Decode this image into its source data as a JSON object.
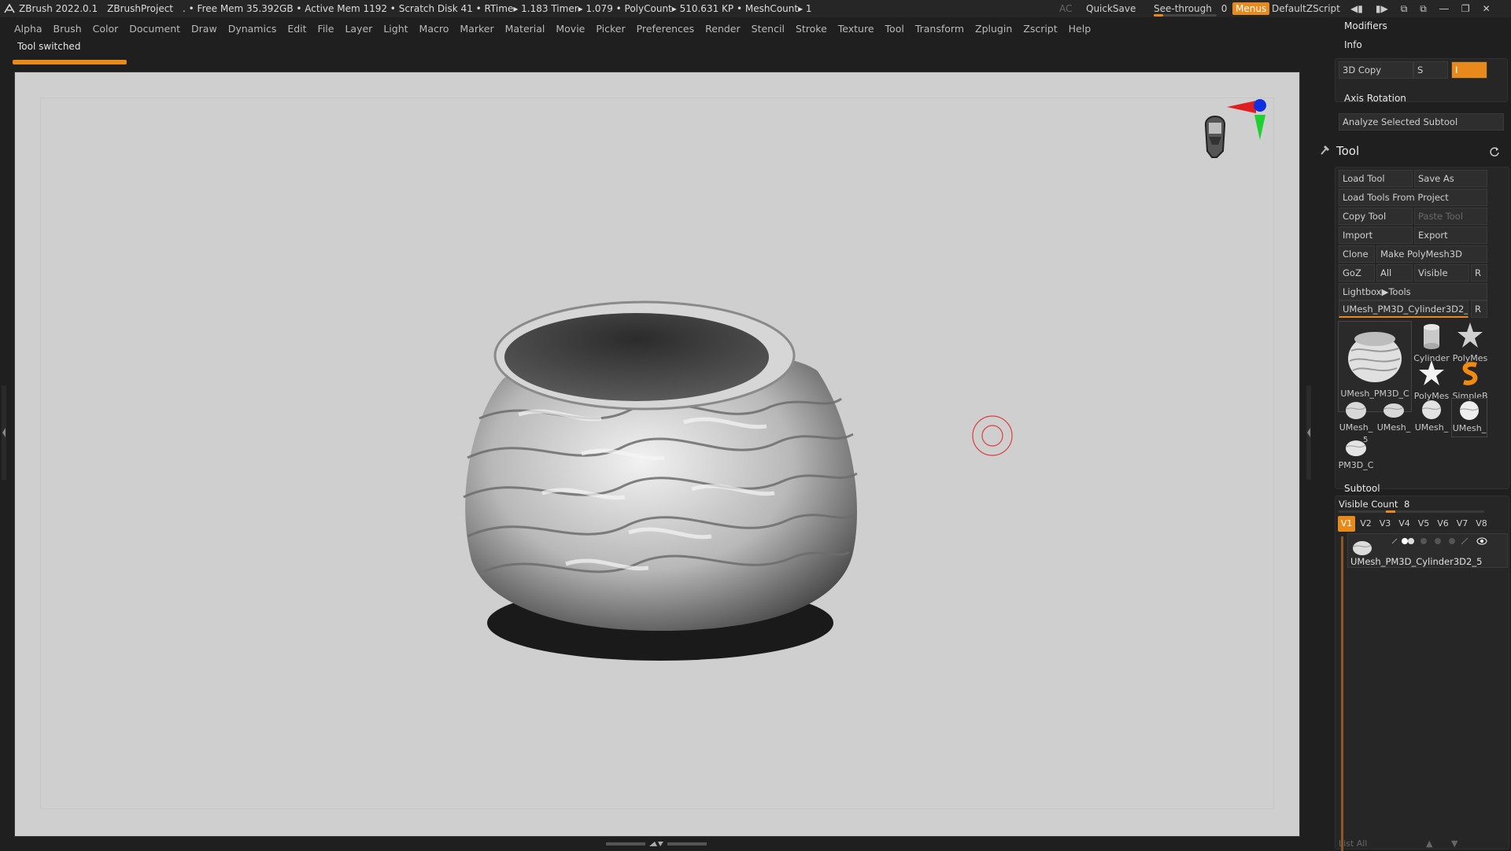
{
  "titlebar": {
    "app": "ZBrush 2022.0.1",
    "project": "ZBrushProject",
    "stats": ". • Free Mem 35.392GB • Active Mem 1192 • Scratch Disk 41 • RTime▸ 1.183 Timer▸ 1.079 • PolyCount▸ 510.631 KP • MeshCount▸ 1",
    "ac": "AC",
    "quicksave": "QuickSave",
    "seethrough_label": "See-through",
    "seethrough_value": "0",
    "seethrough_fraction": 0,
    "menus": "Menus",
    "script": "DefaultZScript"
  },
  "menubar": [
    "Alpha",
    "Brush",
    "Color",
    "Document",
    "Draw",
    "Dynamics",
    "Edit",
    "File",
    "Layer",
    "Light",
    "Macro",
    "Marker",
    "Material",
    "Movie",
    "Picker",
    "Preferences",
    "Render",
    "Stencil",
    "Stroke",
    "Texture",
    "Tool",
    "Transform",
    "Zplugin",
    "Zscript",
    "Help"
  ],
  "notification": {
    "text": "Tool switched"
  },
  "colors": {
    "accent": "#e8891c",
    "canvas": "#cfcfcf",
    "panel": "#1f1f1f"
  },
  "panel": {
    "modifiers": "Modifiers",
    "info": "Info",
    "copy3d": "3D Copy",
    "copy3d_s": "S",
    "copy3d_i": "I",
    "axis_rotation": "Axis Rotation",
    "analyze": "Analyze Selected Subtool",
    "tool_title": "Tool",
    "buttons": {
      "load_tool": "Load Tool",
      "save_as": "Save As",
      "load_from_project": "Load Tools From Project",
      "copy_tool": "Copy Tool",
      "paste_tool": "Paste Tool",
      "import": "Import",
      "export": "Export",
      "clone": "Clone",
      "make_polymesh": "Make PolyMesh3D",
      "goz": "GoZ",
      "all": "All",
      "visible": "Visible",
      "r": "R",
      "lightbox": "Lightbox▶Tools"
    },
    "current_tool": "UMesh_PM3D_Cylinder3D2_5",
    "current_tool_r": "R",
    "thumbs_big": "UMesh_PM3D_C",
    "thumbs": [
      "Cylinder",
      "PolyMes",
      "PolyMes",
      "SimpleB"
    ],
    "thumbs_small": [
      "UMesh_",
      "UMesh_",
      "UMesh_",
      "UMesh_"
    ],
    "thumb_last": "PM3D_C",
    "thumb_last_num": "5",
    "subtool": "Subtool",
    "visible_count_label": "Visible Count",
    "visible_count": "8",
    "visible_count_fraction": 0.1,
    "v_buttons": [
      "V1",
      "V2",
      "V3",
      "V4",
      "V5",
      "V6",
      "V7",
      "V8"
    ],
    "subtool_item": "UMesh_PM3D_Cylinder3D2_5",
    "list_all": "List All"
  }
}
